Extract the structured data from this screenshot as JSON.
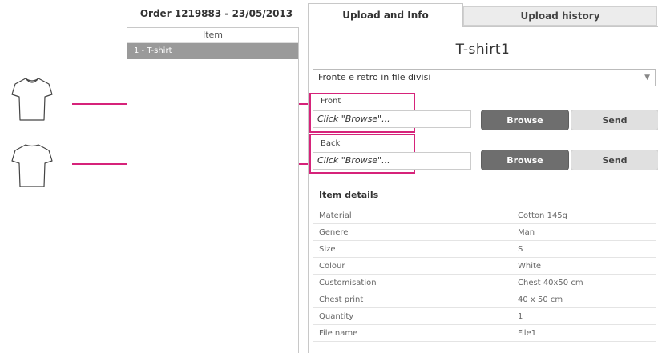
{
  "order": {
    "title": "Order 1219883 - 23/05/2013",
    "column_header": "Item",
    "items": [
      {
        "label": "1 - T-shirt"
      }
    ]
  },
  "tabs": [
    {
      "label": "Upload and Info",
      "active": true
    },
    {
      "label": "Upload history",
      "active": false
    }
  ],
  "product": {
    "title": "T-shirt1"
  },
  "upload_mode": {
    "selected": "Fronte e retro in file divisi"
  },
  "uploads": [
    {
      "label": "Front",
      "placeholder": "Click \"Browse\"...",
      "browse_label": "Browse",
      "send_label": "Send"
    },
    {
      "label": "Back",
      "placeholder": "Click \"Browse\"...",
      "browse_label": "Browse",
      "send_label": "Send"
    }
  ],
  "details": {
    "heading": "Item details",
    "rows": [
      {
        "key": "Material",
        "value": "Cotton 145g"
      },
      {
        "key": "Genere",
        "value": "Man"
      },
      {
        "key": "Size",
        "value": "S"
      },
      {
        "key": "Colour",
        "value": "White"
      },
      {
        "key": "Customisation",
        "value": "Chest 40x50 cm"
      },
      {
        "key": "Chest print",
        "value": "40 x 50 cm"
      },
      {
        "key": "Quantity",
        "value": "1"
      },
      {
        "key": "File name",
        "value": "File1"
      }
    ]
  },
  "icons": {
    "front": "tshirt-front-icon",
    "back": "tshirt-back-icon",
    "dropdown": "chevron-down-icon"
  },
  "colors": {
    "callout": "#d6237a",
    "browse_button": "#6e6e6e",
    "selected_item": "#9a9a9a"
  }
}
